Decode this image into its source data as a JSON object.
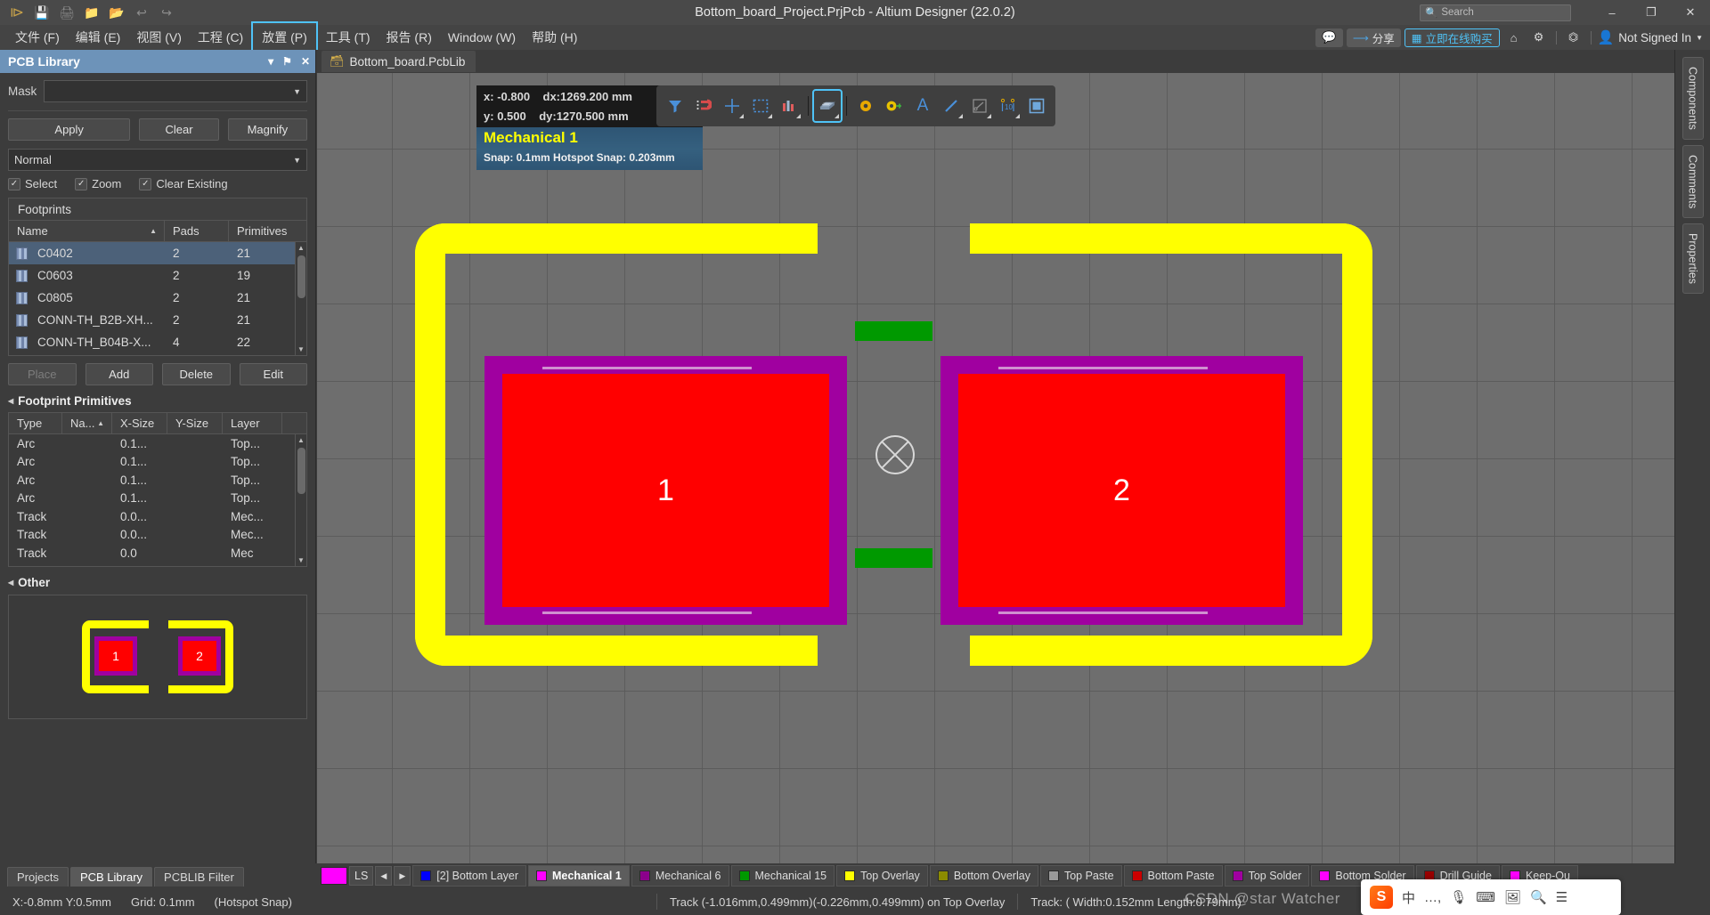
{
  "titlebar": {
    "title": "Bottom_board_Project.PrjPcb - Altium Designer (22.0.2)",
    "search_placeholder": "Search",
    "icons": [
      "altium-logo-icon",
      "save-icon",
      "save-all-icon",
      "open-icon",
      "open-project-icon",
      "undo-icon",
      "redo-icon"
    ],
    "window_buttons": {
      "minimize": "–",
      "maximize": "❐",
      "close": "✕"
    }
  },
  "menubar": {
    "items": [
      {
        "label": "文件 (F)",
        "name": "menu-file"
      },
      {
        "label": "编辑 (E)",
        "name": "menu-edit"
      },
      {
        "label": "视图 (V)",
        "name": "menu-view"
      },
      {
        "label": "工程 (C)",
        "name": "menu-project"
      },
      {
        "label": "放置 (P)",
        "name": "menu-place",
        "highlighted": true
      },
      {
        "label": "工具 (T)",
        "name": "menu-tools"
      },
      {
        "label": "报告 (R)",
        "name": "menu-reports"
      },
      {
        "label": "Window (W)",
        "name": "menu-window"
      },
      {
        "label": "帮助 (H)",
        "name": "menu-help"
      }
    ],
    "right": {
      "comment_label": "▣",
      "share_label": "分享",
      "buy_label": "立即在线购买",
      "home_icon": "home-icon",
      "settings_icon": "gear-icon",
      "connect_icon": "plug-icon",
      "account": "Not Signed In"
    },
    "highlight_color": "#4fc3f7"
  },
  "left_panel": {
    "title": "PCB Library",
    "header_buttons": [
      "▾",
      "⚑",
      "✕"
    ],
    "mask_label": "Mask",
    "mask_value": "",
    "buttons": {
      "apply": "Apply",
      "clear": "Clear",
      "magnify": "Magnify"
    },
    "mode_value": "Normal",
    "checks": [
      {
        "label": "Select",
        "checked": true
      },
      {
        "label": "Zoom",
        "checked": true
      },
      {
        "label": "Clear Existing",
        "checked": true
      }
    ],
    "footprints_title": "Footprints",
    "footprints_columns": [
      "Name",
      "Pads",
      "Primitives"
    ],
    "footprints_rows": [
      {
        "name": "C0402",
        "pads": "2",
        "primitives": "21",
        "selected": true
      },
      {
        "name": "C0603",
        "pads": "2",
        "primitives": "19",
        "selected": false
      },
      {
        "name": "C0805",
        "pads": "2",
        "primitives": "21",
        "selected": false
      },
      {
        "name": "CONN-TH_B2B-XH...",
        "pads": "2",
        "primitives": "21",
        "selected": false
      },
      {
        "name": "CONN-TH_B04B-X...",
        "pads": "4",
        "primitives": "22",
        "selected": false
      }
    ],
    "action_buttons": [
      {
        "label": "Place",
        "disabled": true
      },
      {
        "label": "Add",
        "disabled": false
      },
      {
        "label": "Delete",
        "disabled": false
      },
      {
        "label": "Edit",
        "disabled": false
      }
    ],
    "primitives_title": "Footprint Primitives",
    "primitives_columns": [
      "Type",
      "Na...",
      "X-Size",
      "Y-Size",
      "Layer"
    ],
    "primitives_rows": [
      {
        "type": "Arc",
        "name": "",
        "xsize": "0.1...",
        "ysize": "",
        "layer": "Top..."
      },
      {
        "type": "Arc",
        "name": "",
        "xsize": "0.1...",
        "ysize": "",
        "layer": "Top..."
      },
      {
        "type": "Arc",
        "name": "",
        "xsize": "0.1...",
        "ysize": "",
        "layer": "Top..."
      },
      {
        "type": "Arc",
        "name": "",
        "xsize": "0.1...",
        "ysize": "",
        "layer": "Top..."
      },
      {
        "type": "Track",
        "name": "",
        "xsize": "0.0...",
        "ysize": "",
        "layer": "Mec..."
      },
      {
        "type": "Track",
        "name": "",
        "xsize": "0.0...",
        "ysize": "",
        "layer": "Mec..."
      },
      {
        "type": "Track",
        "name": "",
        "xsize": "0.0",
        "ysize": "",
        "layer": "Mec"
      }
    ],
    "other_title": "Other",
    "preview": {
      "pad1": "1",
      "pad2": "2"
    },
    "tabs": [
      {
        "label": "Projects",
        "active": false
      },
      {
        "label": "PCB Library",
        "active": true
      },
      {
        "label": "PCBLIB Filter",
        "active": false
      }
    ]
  },
  "document": {
    "tab_label": "Bottom_board.PcbLib"
  },
  "canvas": {
    "info": {
      "x_label": "x:",
      "x_value": "-0.800",
      "dx_label": "dx:",
      "dx_value": "1269.200 mm",
      "y_label": "y:",
      "y_value": "0.500",
      "dy_label": "dy:",
      "dy_value": "1270.500 mm",
      "layer": "Mechanical 1",
      "snap": "Snap: 0.1mm Hotspot Snap: 0.203mm"
    },
    "toolbar_icons": [
      {
        "name": "filter-icon",
        "glyph": "▼",
        "dropdown": false
      },
      {
        "name": "magnet-snap-icon",
        "glyph": "⊃",
        "dropdown": false
      },
      {
        "name": "crosshair-place-icon",
        "glyph": "✚",
        "dropdown": true
      },
      {
        "name": "select-region-icon",
        "glyph": "⬚",
        "dropdown": true
      },
      {
        "name": "measure-icon",
        "glyph": "▐",
        "dropdown": true
      },
      {
        "name": "place-component-icon",
        "glyph": "▰",
        "dropdown": true,
        "highlighted": true
      },
      {
        "name": "via-icon",
        "glyph": "◉",
        "dropdown": false
      },
      {
        "name": "place-pad-icon",
        "glyph": "⚷",
        "dropdown": false
      },
      {
        "name": "place-text-icon",
        "glyph": "A",
        "dropdown": false
      },
      {
        "name": "place-line-icon",
        "glyph": "╱",
        "dropdown": true
      },
      {
        "name": "place-polygon-icon",
        "glyph": "◱",
        "dropdown": true
      },
      {
        "name": "place-dimension-icon",
        "glyph": "⋮10",
        "dropdown": true
      },
      {
        "name": "place-fill-icon",
        "glyph": "▣",
        "dropdown": false
      }
    ],
    "footprint": {
      "pad1_label": "1",
      "pad2_label": "2"
    }
  },
  "right_dock": {
    "tabs": [
      "Components",
      "Comments",
      "Properties"
    ]
  },
  "layer_bar": {
    "ls_label": "LS",
    "prev": "◀",
    "next": "▶",
    "layers": [
      {
        "label": "[2] Bottom Layer",
        "color": "#0000ff",
        "active": false
      },
      {
        "label": "Mechanical 1",
        "color": "#ff00ff",
        "active": true
      },
      {
        "label": "Mechanical 6",
        "color": "#8b008b",
        "active": false
      },
      {
        "label": "Mechanical 15",
        "color": "#009900",
        "active": false
      },
      {
        "label": "Top Overlay",
        "color": "#ffff00",
        "active": false
      },
      {
        "label": "Bottom Overlay",
        "color": "#8b8b00",
        "active": false
      },
      {
        "label": "Top Paste",
        "color": "#999999",
        "active": false
      },
      {
        "label": "Bottom Paste",
        "color": "#cc0000",
        "active": false
      },
      {
        "label": "Top Solder",
        "color": "#a000a0",
        "active": false
      },
      {
        "label": "Bottom Solder",
        "color": "#ff00ff",
        "active": false
      },
      {
        "label": "Drill Guide",
        "color": "#990000",
        "active": false
      },
      {
        "label": "Keep-Ou",
        "color": "#ff00ff",
        "active": false
      }
    ]
  },
  "statusbar": {
    "coords": "X:-0.8mm Y:0.5mm",
    "grid": "Grid: 0.1mm",
    "snap_mode": "(Hotspot Snap)",
    "track_info": "Track (-1.016mm,0.499mm)(-0.226mm,0.499mm) on Top Overlay",
    "track_props": "Track: ( Width:0.152mm Length:0.79mm)"
  },
  "ime_tray": {
    "logo": "S",
    "mode": "中",
    "items": [
      "…,",
      "🎙",
      "⌨",
      "🖼",
      "🔍",
      "☰"
    ]
  },
  "watermark": "CSDN @star Watcher"
}
